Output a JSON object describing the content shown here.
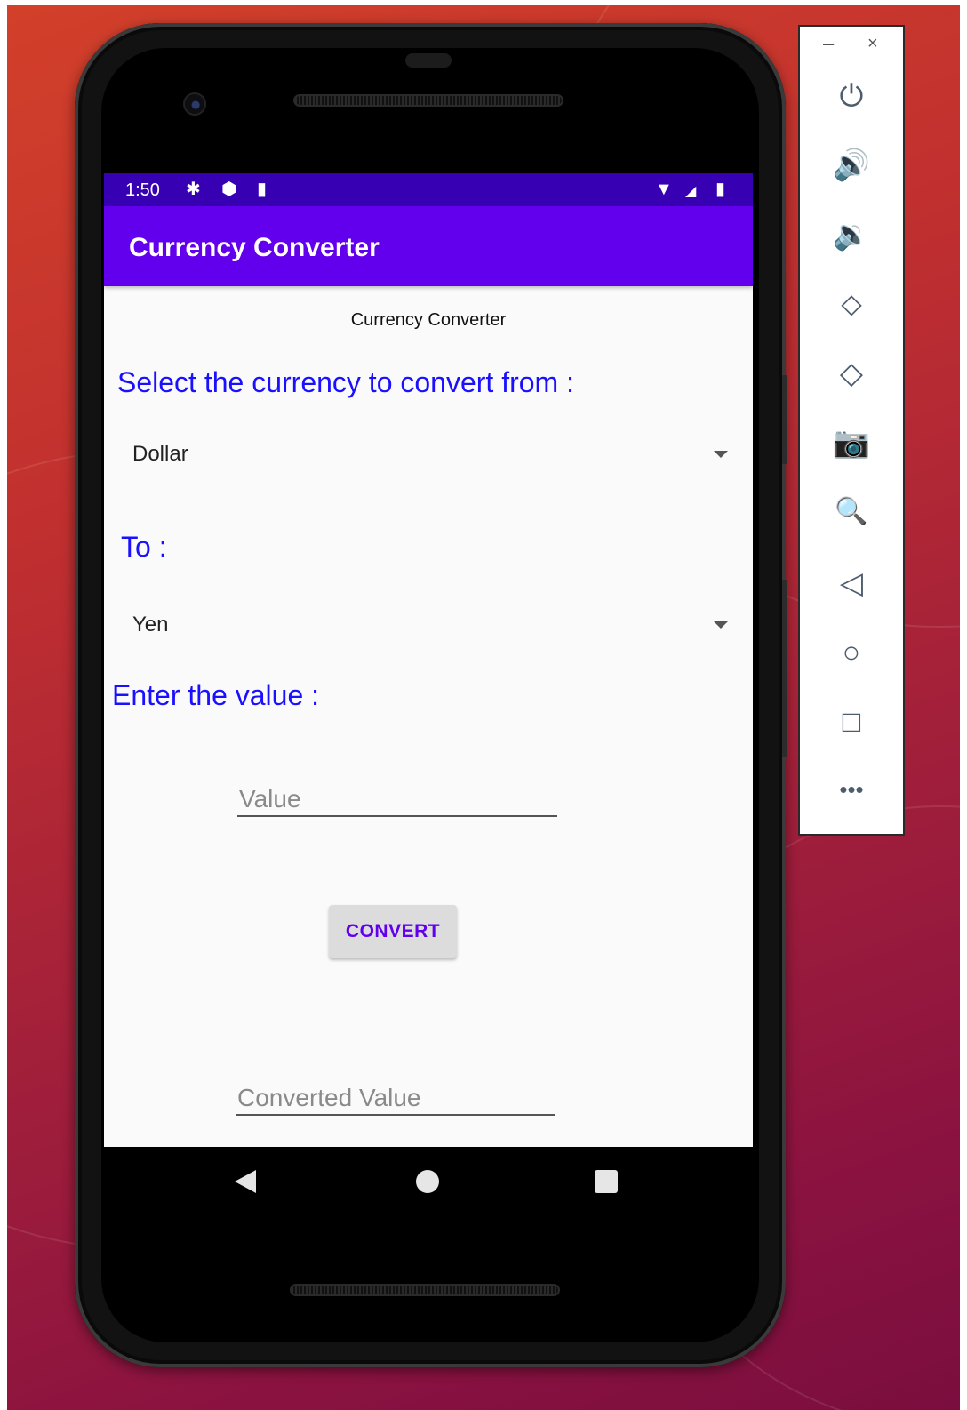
{
  "statusbar": {
    "time": "1:50",
    "icons": [
      "settings-icon",
      "shield-icon",
      "sd-card-icon",
      "wifi-icon",
      "signal-icon",
      "battery-icon"
    ]
  },
  "appbar": {
    "title": "Currency Converter"
  },
  "main": {
    "header": "Currency Converter",
    "from_label": "Select the currency to convert from :",
    "from_value": "Dollar",
    "to_label": "To :",
    "to_value": "Yen",
    "value_label": "Enter the value :",
    "value_hint": "Value",
    "convert_label": "CONVERT",
    "result_hint": "Converted Value"
  },
  "nav": {
    "icons": [
      "back-icon",
      "home-icon",
      "recents-icon"
    ]
  },
  "emulator_toolbar": {
    "minimize": "–",
    "close": "×",
    "icons": [
      "power-icon",
      "volume-up-icon",
      "volume-down-icon",
      "rotate-left-icon",
      "rotate-right-icon",
      "camera-icon",
      "zoom-icon",
      "back-icon",
      "home-icon",
      "overview-icon",
      "more-icon"
    ]
  },
  "colors": {
    "statusbar": "#3700b3",
    "appbar": "#6200ee",
    "label_blue": "#1a10ff",
    "button_text": "#6200ee"
  }
}
